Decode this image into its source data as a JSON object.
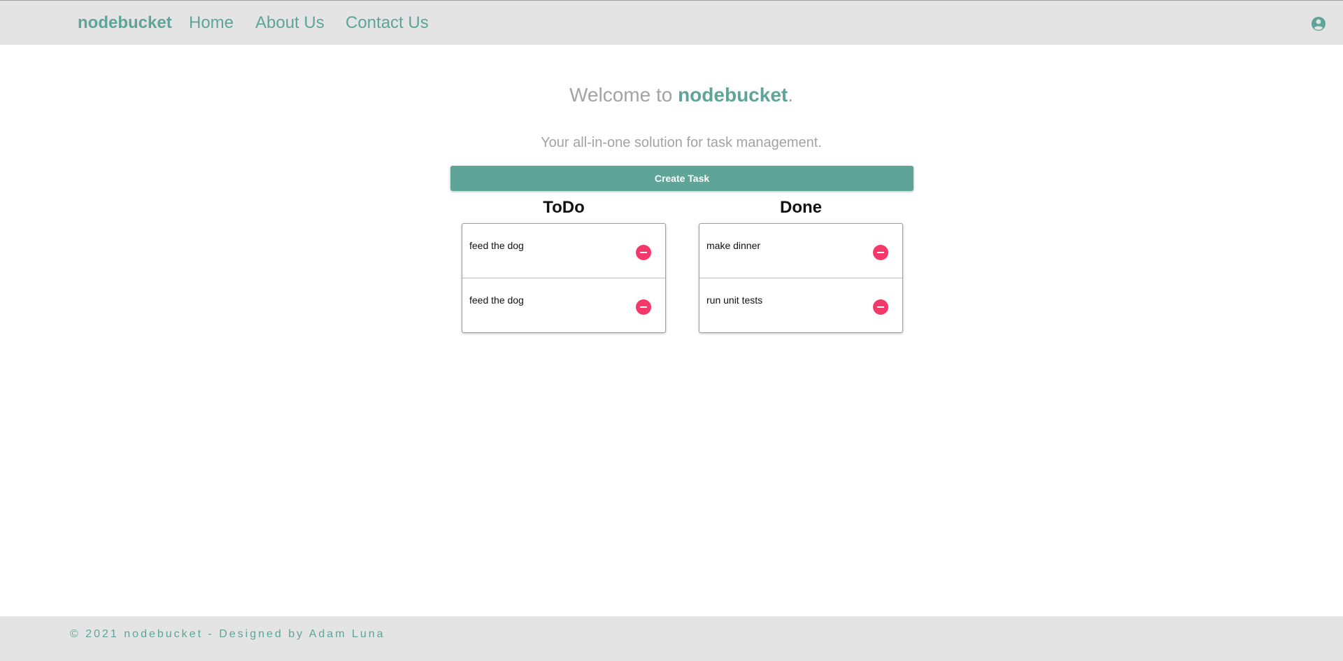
{
  "nav": {
    "brand": "nodebucket",
    "links": [
      "Home",
      "About Us",
      "Contact Us"
    ],
    "account_icon": "account-circle-icon"
  },
  "main": {
    "welcome_prefix": "Welcome to ",
    "welcome_brand": "nodebucket",
    "welcome_suffix": ".",
    "subtitle": "Your all-in-one solution for task management.",
    "create_button": "Create Task"
  },
  "columns": {
    "todo": {
      "title": "ToDo",
      "tasks": [
        "feed the dog",
        "feed the dog"
      ]
    },
    "done": {
      "title": "Done",
      "tasks": [
        "make dinner",
        "run unit tests"
      ]
    }
  },
  "footer": {
    "text": "© 2021 nodebucket - Designed by Adam Luna"
  },
  "colors": {
    "accent": "#5ea498",
    "delete": "#f5386a",
    "bar_bg": "#e4e4e4",
    "muted_text": "#a3a3a3"
  },
  "icons": {
    "delete": "remove-circle-icon"
  }
}
